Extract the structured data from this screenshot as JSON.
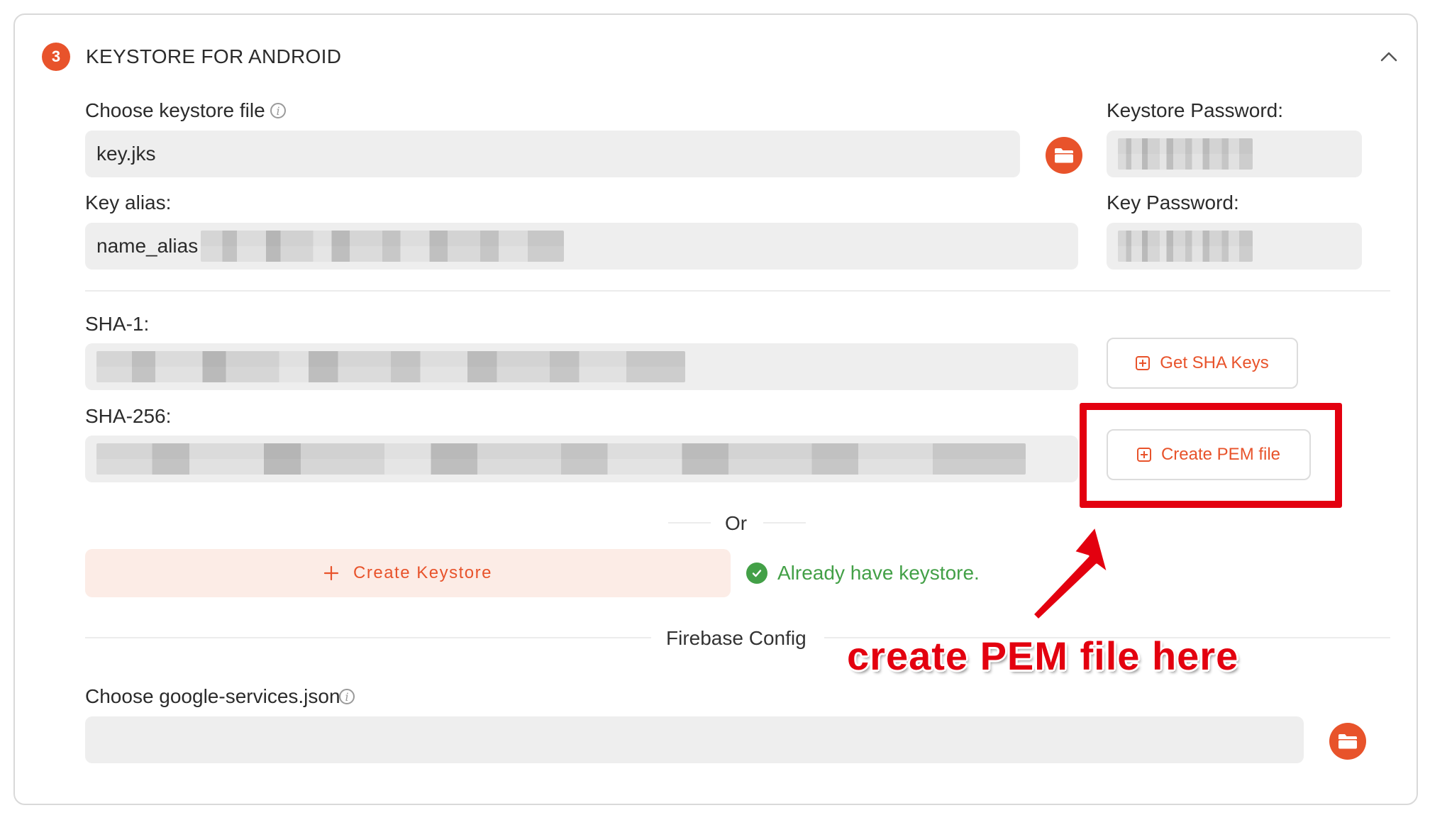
{
  "section": {
    "step_number": "3",
    "title": "KEYSTORE FOR ANDROID"
  },
  "keystore_file": {
    "label": "Choose keystore file",
    "value": "key.jks"
  },
  "keystore_password": {
    "label": "Keystore Password:"
  },
  "key_alias": {
    "label": "Key alias:",
    "value": "name_alias"
  },
  "key_password": {
    "label": "Key Password:"
  },
  "sha1": {
    "label": "SHA-1:"
  },
  "sha256": {
    "label": "SHA-256:"
  },
  "buttons": {
    "get_sha_keys": "Get SHA Keys",
    "create_pem_file": "Create PEM file",
    "create_keystore": "Create Keystore"
  },
  "or_text": "Or",
  "status": {
    "already_have_keystore": "Already have keystore."
  },
  "firebase": {
    "title": "Firebase Config",
    "google_services_label": "Choose google-services.json",
    "google_services_value": ""
  },
  "annotation": {
    "text": "create PEM file here"
  },
  "colors": {
    "accent": "#e8532b",
    "success": "#43a047",
    "annotation_red": "#e3000f",
    "field_bg": "#eeeeee",
    "create_keystore_bg": "#fcece6"
  },
  "icons": {
    "step": "step-number-badge",
    "collapse": "chevron-up-icon",
    "info": "info-icon",
    "folder": "folder-icon",
    "plus_square": "plus-square-icon",
    "plus": "plus-icon",
    "check": "check-circle-icon",
    "arrow": "arrow-icon"
  }
}
